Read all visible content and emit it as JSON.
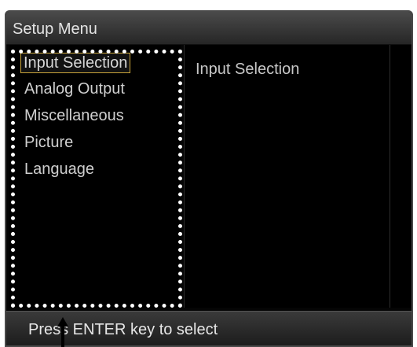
{
  "window": {
    "title": "Setup Menu"
  },
  "menu": {
    "items": [
      {
        "label": "Input Selection",
        "selected": true
      },
      {
        "label": "Analog Output",
        "selected": false
      },
      {
        "label": "Miscellaneous",
        "selected": false
      },
      {
        "label": "Picture",
        "selected": false
      },
      {
        "label": "Language",
        "selected": false
      }
    ]
  },
  "detail": {
    "title": "Input Selection"
  },
  "status": {
    "text": "Press ENTER key to select"
  },
  "icons": {
    "pointer": "up-arrow-icon"
  },
  "colors": {
    "selection_border": "#c9a43a",
    "annotation_frame": "#ffffff",
    "background": "#050505"
  }
}
